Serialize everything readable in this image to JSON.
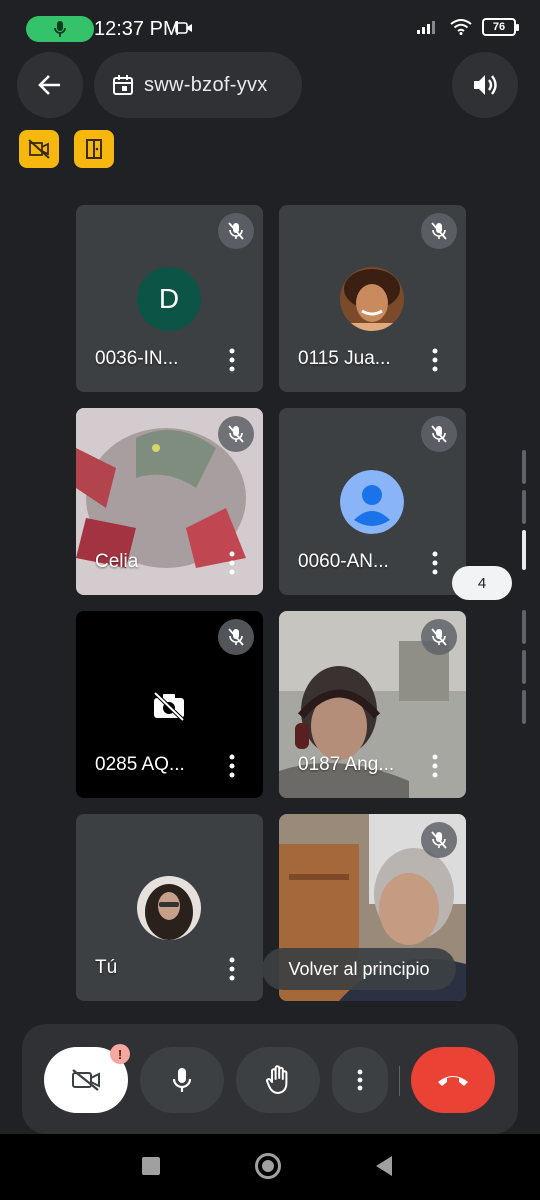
{
  "status_bar": {
    "time": "12:37 PM",
    "battery": "76",
    "icons": [
      "mic-icon",
      "camera-recording-icon",
      "signal-icon",
      "wifi-icon",
      "battery-icon"
    ]
  },
  "top_bar": {
    "meeting_code": "sww-bzof-yvx",
    "back_icon": "arrow-left-icon",
    "calendar_icon": "calendar-icon",
    "audio_icon": "speaker-icon"
  },
  "host_badges": [
    "no-video-lock-icon",
    "door-exit-icon"
  ],
  "colors": {
    "accent_green": "#34c26a",
    "host_badge": "#f6b80f",
    "end_call": "#ea4335",
    "tile_bg": "#3c4043",
    "avatar_green": "#0b5446",
    "avatar_blue": "#8ab4f8"
  },
  "participants": [
    {
      "name": "0036-IN...",
      "avatar": "D",
      "muted": true
    },
    {
      "name": "0115 Jua...",
      "muted": true
    },
    {
      "name": "Celia",
      "muted": true
    },
    {
      "name": "0060-AN...",
      "muted": true
    },
    {
      "name": "0285 AQ...",
      "camera_off": true,
      "muted": true
    },
    {
      "name": "0187 Ang...",
      "muted": true
    },
    {
      "name": "Tú"
    },
    {
      "name": "",
      "muted": true
    }
  ],
  "page_indicator": "4",
  "back_to_top_label": "Volver al principio",
  "controls": {
    "camera_warning": "!",
    "buttons": [
      "camera-off-icon",
      "mic-icon",
      "raise-hand-icon",
      "more-vert-icon",
      "end-call-icon"
    ]
  },
  "nav_bar": [
    "recents-square-icon",
    "home-circle-icon",
    "back-triangle-icon"
  ]
}
